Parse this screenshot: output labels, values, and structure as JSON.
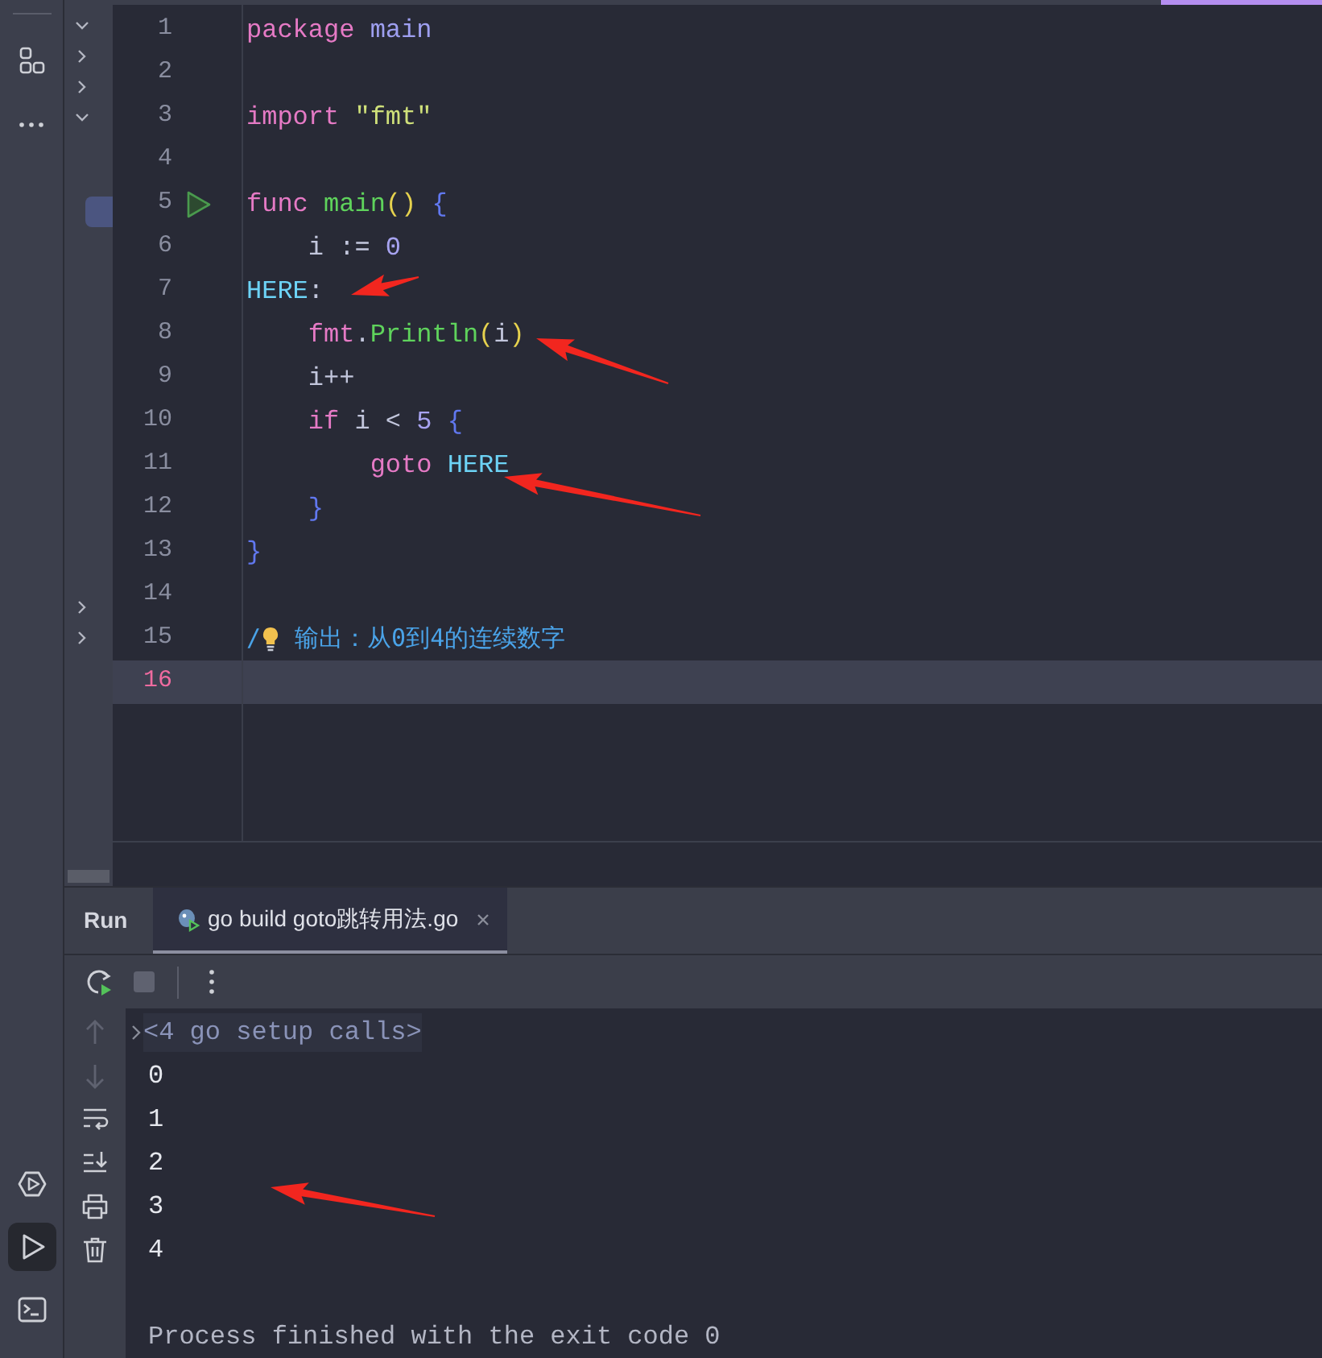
{
  "tool_stripe": {
    "top": [
      {
        "kind": "structure"
      },
      {
        "kind": "more"
      }
    ],
    "bottom": [
      {
        "kind": "services",
        "selected": false
      },
      {
        "kind": "run",
        "selected": true
      },
      {
        "kind": "terminal",
        "selected": false
      }
    ]
  },
  "project_tree": {
    "rows": [
      {
        "kind": "folder",
        "expanded": true
      },
      {
        "kind": "folder",
        "expanded": false
      },
      {
        "kind": "folder",
        "expanded": false
      },
      {
        "kind": "folder",
        "expanded": true
      },
      {
        "kind": "file",
        "selected": true
      },
      {
        "kind": "folder",
        "expanded": false
      },
      {
        "kind": "folder",
        "expanded": false
      }
    ]
  },
  "editor": {
    "lines": [
      {
        "number": "1",
        "current": false,
        "run_marker": false,
        "tokens": [
          {
            "text": "package",
            "kind": "keyword"
          },
          {
            "text": " main",
            "kind": "package"
          }
        ]
      },
      {
        "number": "2",
        "current": false,
        "run_marker": false
      },
      {
        "number": "3",
        "current": false,
        "run_marker": false,
        "tokens": [
          {
            "text": "import",
            "kind": "keyword"
          },
          {
            "text": " \"fmt\"",
            "kind": "string"
          }
        ]
      },
      {
        "number": "4",
        "current": false,
        "run_marker": false
      },
      {
        "number": "5",
        "current": false,
        "run_marker": true,
        "tokens": [
          {
            "text": "func",
            "kind": "keyword"
          },
          {
            "text": " main",
            "kind": "function"
          },
          {
            "text": "()",
            "kind": "paren"
          },
          {
            "text": " {",
            "kind": "brace"
          }
        ]
      },
      {
        "number": "6",
        "current": false,
        "run_marker": false,
        "tokens": [
          {
            "text": "    i := "
          },
          {
            "text": "0",
            "kind": "number"
          }
        ]
      },
      {
        "number": "7",
        "current": false,
        "run_marker": false,
        "tokens": [
          {
            "text": "HERE",
            "kind": "label"
          },
          {
            "text": ":"
          }
        ]
      },
      {
        "number": "8",
        "current": false,
        "run_marker": false,
        "tokens": [
          {
            "text": "    fmt",
            "kind": "keyword"
          },
          {
            "text": "."
          },
          {
            "text": "Println",
            "kind": "function"
          },
          {
            "text": "(",
            "kind": "paren"
          },
          {
            "text": "i"
          },
          {
            "text": ")",
            "kind": "paren"
          }
        ]
      },
      {
        "number": "9",
        "current": false,
        "run_marker": false,
        "tokens": [
          {
            "text": "    i++"
          }
        ]
      },
      {
        "number": "10",
        "current": false,
        "run_marker": false,
        "tokens": [
          {
            "text": "    if",
            "kind": "keyword"
          },
          {
            "text": " i < "
          },
          {
            "text": "5",
            "kind": "number"
          },
          {
            "text": " {",
            "kind": "brace"
          }
        ]
      },
      {
        "number": "11",
        "current": false,
        "run_marker": false,
        "tokens": [
          {
            "text": "        goto",
            "kind": "keyword"
          },
          {
            "text": " HERE",
            "kind": "label"
          }
        ]
      },
      {
        "number": "12",
        "current": false,
        "run_marker": false,
        "tokens": [
          {
            "text": "    }",
            "kind": "brace"
          }
        ]
      },
      {
        "number": "13",
        "current": false,
        "run_marker": false,
        "tokens": [
          {
            "text": "}",
            "kind": "brace"
          }
        ]
      },
      {
        "number": "14",
        "current": false,
        "run_marker": false
      },
      {
        "number": "15",
        "current": false,
        "run_marker": false,
        "tokens": [
          {
            "text": "/",
            "kind": "comment"
          },
          {
            "kind": "bulb"
          },
          {
            "text": " 输出：从0到4的连续数字",
            "kind": "comment"
          }
        ]
      },
      {
        "number": "16",
        "current": true,
        "run_marker": false
      }
    ]
  },
  "run_panel": {
    "title": "Run",
    "tabs": [
      {
        "label": "go build goto跳转用法.go",
        "selected": true
      }
    ],
    "actions": [
      {
        "kind": "rerun",
        "disabled": false
      },
      {
        "kind": "stop",
        "disabled": true
      },
      {
        "kind": "more",
        "disabled": false
      }
    ],
    "side_tools": [
      {
        "kind": "up",
        "disabled": true
      },
      {
        "kind": "down",
        "disabled": true
      },
      {
        "kind": "wrap",
        "disabled": false
      },
      {
        "kind": "scroll_end",
        "disabled": false
      },
      {
        "kind": "print",
        "disabled": false
      },
      {
        "kind": "trash",
        "disabled": false
      }
    ],
    "output": [
      {
        "kind": "folded",
        "text": "<4 go setup calls>"
      },
      {
        "kind": "stdout",
        "text": "0"
      },
      {
        "kind": "stdout",
        "text": "1"
      },
      {
        "kind": "stdout",
        "text": "2"
      },
      {
        "kind": "stdout",
        "text": "3"
      },
      {
        "kind": "stdout",
        "text": "4"
      },
      {
        "kind": "system",
        "text": "Process finished with the exit code 0"
      }
    ]
  }
}
